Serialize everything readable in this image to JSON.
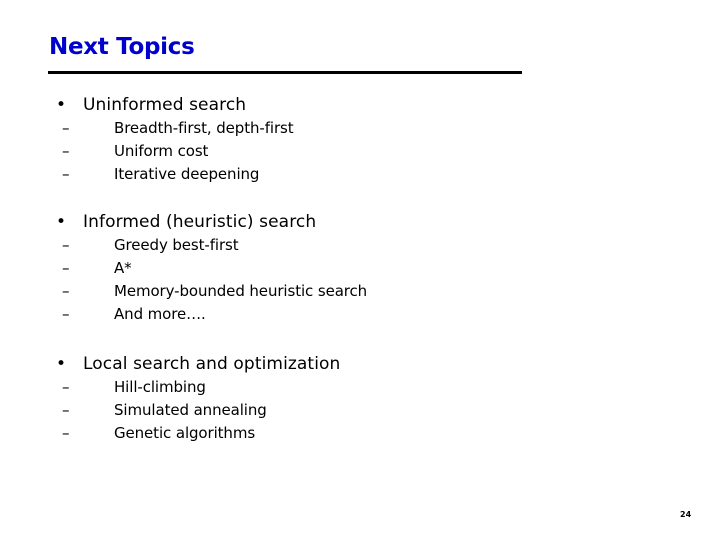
{
  "slide": {
    "title": "Next Topics",
    "title_color": "#0000cc",
    "page_number": "24"
  },
  "sections": [
    {
      "bullet": "•",
      "label": "Uninformed search",
      "items": [
        {
          "dash": "–",
          "label": "Breadth-first, depth-first"
        },
        {
          "dash": "–",
          "label": "Uniform cost"
        },
        {
          "dash": "–",
          "label": "Iterative deepening"
        }
      ]
    },
    {
      "bullet": "•",
      "label": "Informed (heuristic) search",
      "items": [
        {
          "dash": "–",
          "label": "Greedy best-first"
        },
        {
          "dash": "–",
          "label": "A*"
        },
        {
          "dash": "–",
          "label": "Memory-bounded heuristic search"
        },
        {
          "dash": "–",
          "label": "And more…."
        }
      ]
    },
    {
      "bullet": "•",
      "label": "Local search and optimization",
      "items": [
        {
          "dash": "–",
          "label": "Hill-climbing"
        },
        {
          "dash": "–",
          "label": "Simulated annealing"
        },
        {
          "dash": "–",
          "label": "Genetic algorithms"
        }
      ]
    }
  ]
}
